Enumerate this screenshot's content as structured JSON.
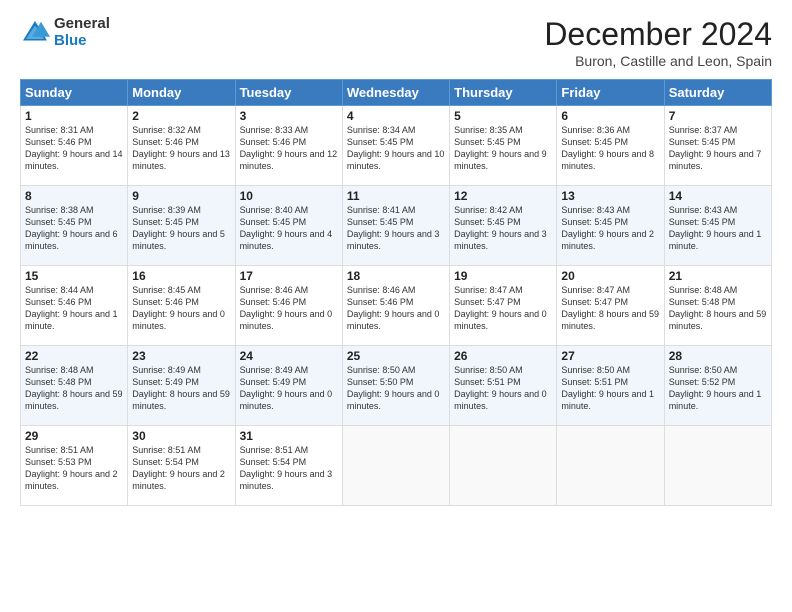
{
  "logo": {
    "general": "General",
    "blue": "Blue"
  },
  "title": "December 2024",
  "subtitle": "Buron, Castille and Leon, Spain",
  "days_header": [
    "Sunday",
    "Monday",
    "Tuesday",
    "Wednesday",
    "Thursday",
    "Friday",
    "Saturday"
  ],
  "weeks": [
    [
      {
        "day": "1",
        "sunrise": "8:31 AM",
        "sunset": "5:46 PM",
        "daylight": "9 hours and 14 minutes."
      },
      {
        "day": "2",
        "sunrise": "8:32 AM",
        "sunset": "5:46 PM",
        "daylight": "9 hours and 13 minutes."
      },
      {
        "day": "3",
        "sunrise": "8:33 AM",
        "sunset": "5:46 PM",
        "daylight": "9 hours and 12 minutes."
      },
      {
        "day": "4",
        "sunrise": "8:34 AM",
        "sunset": "5:45 PM",
        "daylight": "9 hours and 10 minutes."
      },
      {
        "day": "5",
        "sunrise": "8:35 AM",
        "sunset": "5:45 PM",
        "daylight": "9 hours and 9 minutes."
      },
      {
        "day": "6",
        "sunrise": "8:36 AM",
        "sunset": "5:45 PM",
        "daylight": "9 hours and 8 minutes."
      },
      {
        "day": "7",
        "sunrise": "8:37 AM",
        "sunset": "5:45 PM",
        "daylight": "9 hours and 7 minutes."
      }
    ],
    [
      {
        "day": "8",
        "sunrise": "8:38 AM",
        "sunset": "5:45 PM",
        "daylight": "9 hours and 6 minutes."
      },
      {
        "day": "9",
        "sunrise": "8:39 AM",
        "sunset": "5:45 PM",
        "daylight": "9 hours and 5 minutes."
      },
      {
        "day": "10",
        "sunrise": "8:40 AM",
        "sunset": "5:45 PM",
        "daylight": "9 hours and 4 minutes."
      },
      {
        "day": "11",
        "sunrise": "8:41 AM",
        "sunset": "5:45 PM",
        "daylight": "9 hours and 3 minutes."
      },
      {
        "day": "12",
        "sunrise": "8:42 AM",
        "sunset": "5:45 PM",
        "daylight": "9 hours and 3 minutes."
      },
      {
        "day": "13",
        "sunrise": "8:43 AM",
        "sunset": "5:45 PM",
        "daylight": "9 hours and 2 minutes."
      },
      {
        "day": "14",
        "sunrise": "8:43 AM",
        "sunset": "5:45 PM",
        "daylight": "9 hours and 1 minute."
      }
    ],
    [
      {
        "day": "15",
        "sunrise": "8:44 AM",
        "sunset": "5:46 PM",
        "daylight": "9 hours and 1 minute."
      },
      {
        "day": "16",
        "sunrise": "8:45 AM",
        "sunset": "5:46 PM",
        "daylight": "9 hours and 0 minutes."
      },
      {
        "day": "17",
        "sunrise": "8:46 AM",
        "sunset": "5:46 PM",
        "daylight": "9 hours and 0 minutes."
      },
      {
        "day": "18",
        "sunrise": "8:46 AM",
        "sunset": "5:46 PM",
        "daylight": "9 hours and 0 minutes."
      },
      {
        "day": "19",
        "sunrise": "8:47 AM",
        "sunset": "5:47 PM",
        "daylight": "9 hours and 0 minutes."
      },
      {
        "day": "20",
        "sunrise": "8:47 AM",
        "sunset": "5:47 PM",
        "daylight": "8 hours and 59 minutes."
      },
      {
        "day": "21",
        "sunrise": "8:48 AM",
        "sunset": "5:48 PM",
        "daylight": "8 hours and 59 minutes."
      }
    ],
    [
      {
        "day": "22",
        "sunrise": "8:48 AM",
        "sunset": "5:48 PM",
        "daylight": "8 hours and 59 minutes."
      },
      {
        "day": "23",
        "sunrise": "8:49 AM",
        "sunset": "5:49 PM",
        "daylight": "8 hours and 59 minutes."
      },
      {
        "day": "24",
        "sunrise": "8:49 AM",
        "sunset": "5:49 PM",
        "daylight": "9 hours and 0 minutes."
      },
      {
        "day": "25",
        "sunrise": "8:50 AM",
        "sunset": "5:50 PM",
        "daylight": "9 hours and 0 minutes."
      },
      {
        "day": "26",
        "sunrise": "8:50 AM",
        "sunset": "5:51 PM",
        "daylight": "9 hours and 0 minutes."
      },
      {
        "day": "27",
        "sunrise": "8:50 AM",
        "sunset": "5:51 PM",
        "daylight": "9 hours and 1 minute."
      },
      {
        "day": "28",
        "sunrise": "8:50 AM",
        "sunset": "5:52 PM",
        "daylight": "9 hours and 1 minute."
      }
    ],
    [
      {
        "day": "29",
        "sunrise": "8:51 AM",
        "sunset": "5:53 PM",
        "daylight": "9 hours and 2 minutes."
      },
      {
        "day": "30",
        "sunrise": "8:51 AM",
        "sunset": "5:54 PM",
        "daylight": "9 hours and 2 minutes."
      },
      {
        "day": "31",
        "sunrise": "8:51 AM",
        "sunset": "5:54 PM",
        "daylight": "9 hours and 3 minutes."
      },
      null,
      null,
      null,
      null
    ]
  ]
}
